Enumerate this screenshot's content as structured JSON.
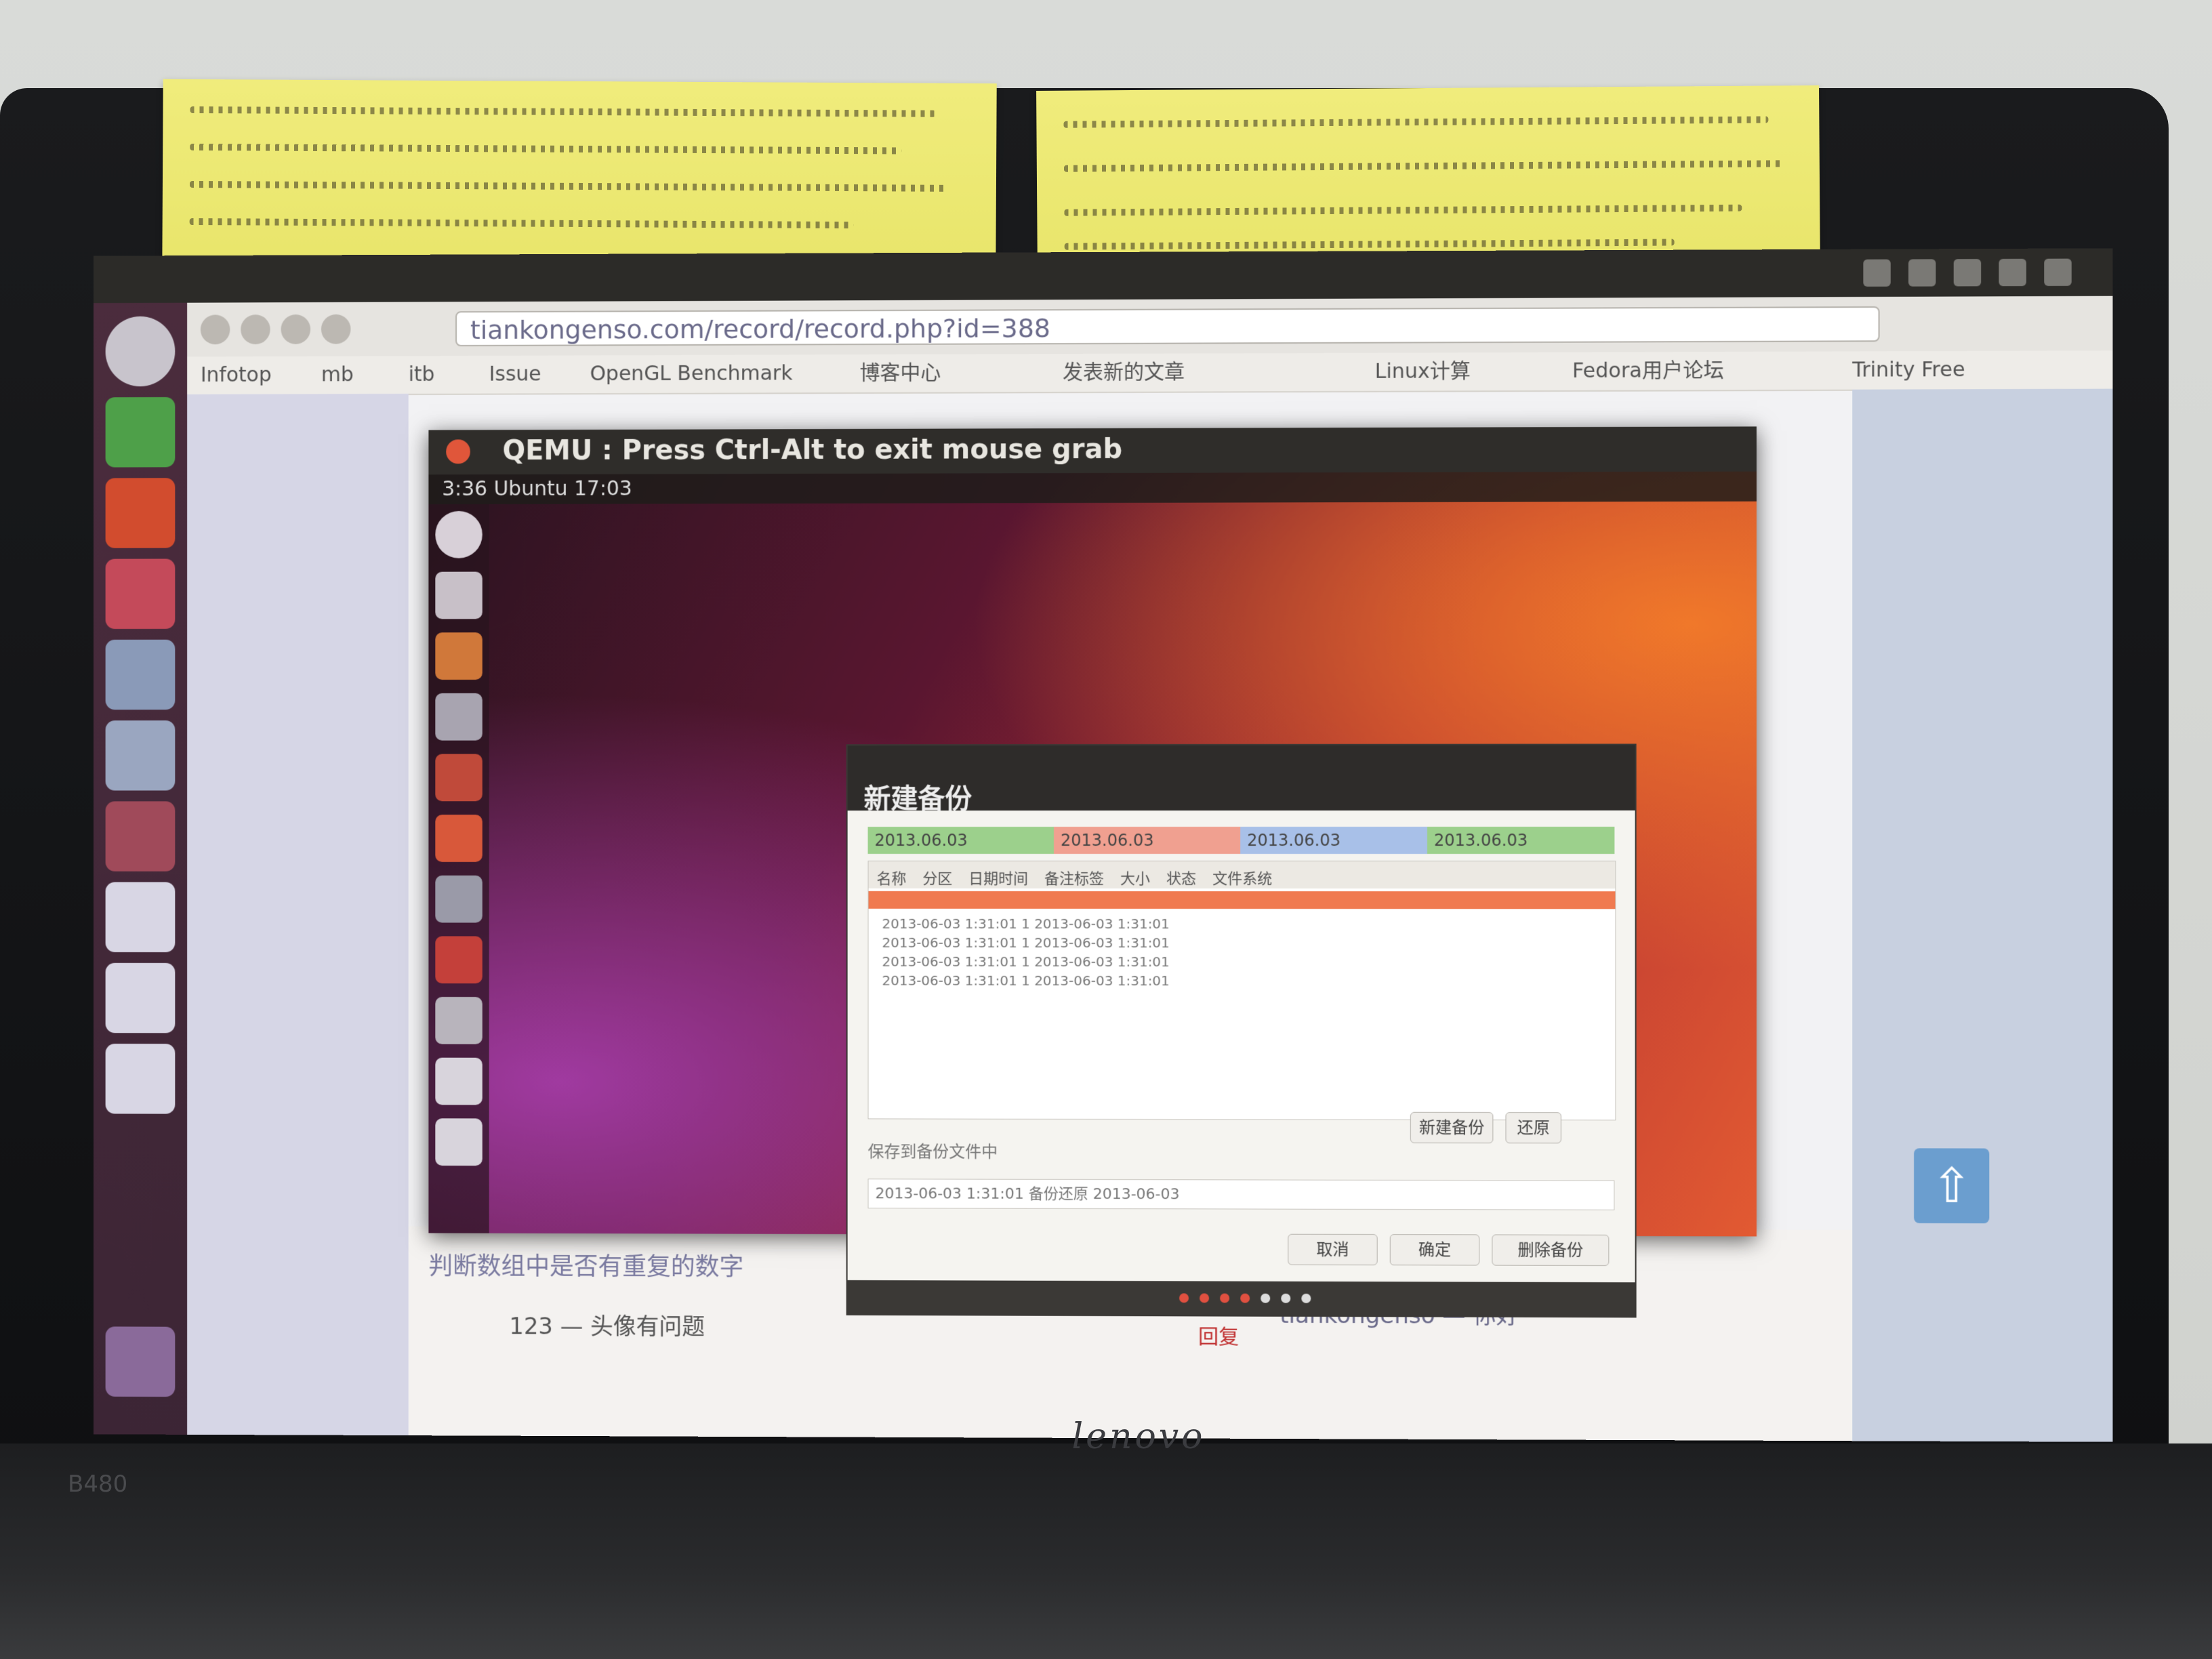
{
  "browser": {
    "url": "tiankongenso.com/record/record.php?id=388",
    "bookmarks": [
      "Infotop",
      "mb",
      "itb",
      "Issue",
      "OpenGL Benchmark",
      "博客中心",
      "发表新的文章",
      "Linux计算",
      "Fedora用户论坛",
      "Trinity Free"
    ]
  },
  "vm": {
    "title": "QEMU : Press Ctrl-Alt to exit mouse grab",
    "clock": "3:36 Ubuntu 17:03",
    "dialog": {
      "title": "新建备份",
      "tabs": [
        "2013.06.03",
        "2013.06.03",
        "2013.06.03",
        "2013.06.03"
      ],
      "columns": [
        "名称",
        "分区",
        "日期时间",
        "备注标签",
        "大小",
        "状态",
        "文件系统"
      ],
      "rows": [
        "2013-06-03  1:31:01     1     2013-06-03  1:31:01",
        "2013-06-03  1:31:01     1     2013-06-03  1:31:01",
        "2013-06-03  1:31:01     1     2013-06-03  1:31:01",
        "2013-06-03  1:31:01     1     2013-06-03  1:31:01"
      ],
      "status": "保存到备份文件中",
      "field_value": "2013-06-03  1:31:01 备份还原 2013-06-03",
      "buttons": [
        "新建备份",
        "还原",
        "取消",
        "确定",
        "删除备份"
      ]
    }
  },
  "page": {
    "comment_line": "判断数组中是否有重复的数字",
    "comment_reply": "123 — 头像有问题",
    "comment_right": "tiankongenso — 你好",
    "comment_link": "回复",
    "upload_icon": "⇧"
  },
  "laptop": {
    "brand": "lenovo",
    "model": "B480"
  }
}
